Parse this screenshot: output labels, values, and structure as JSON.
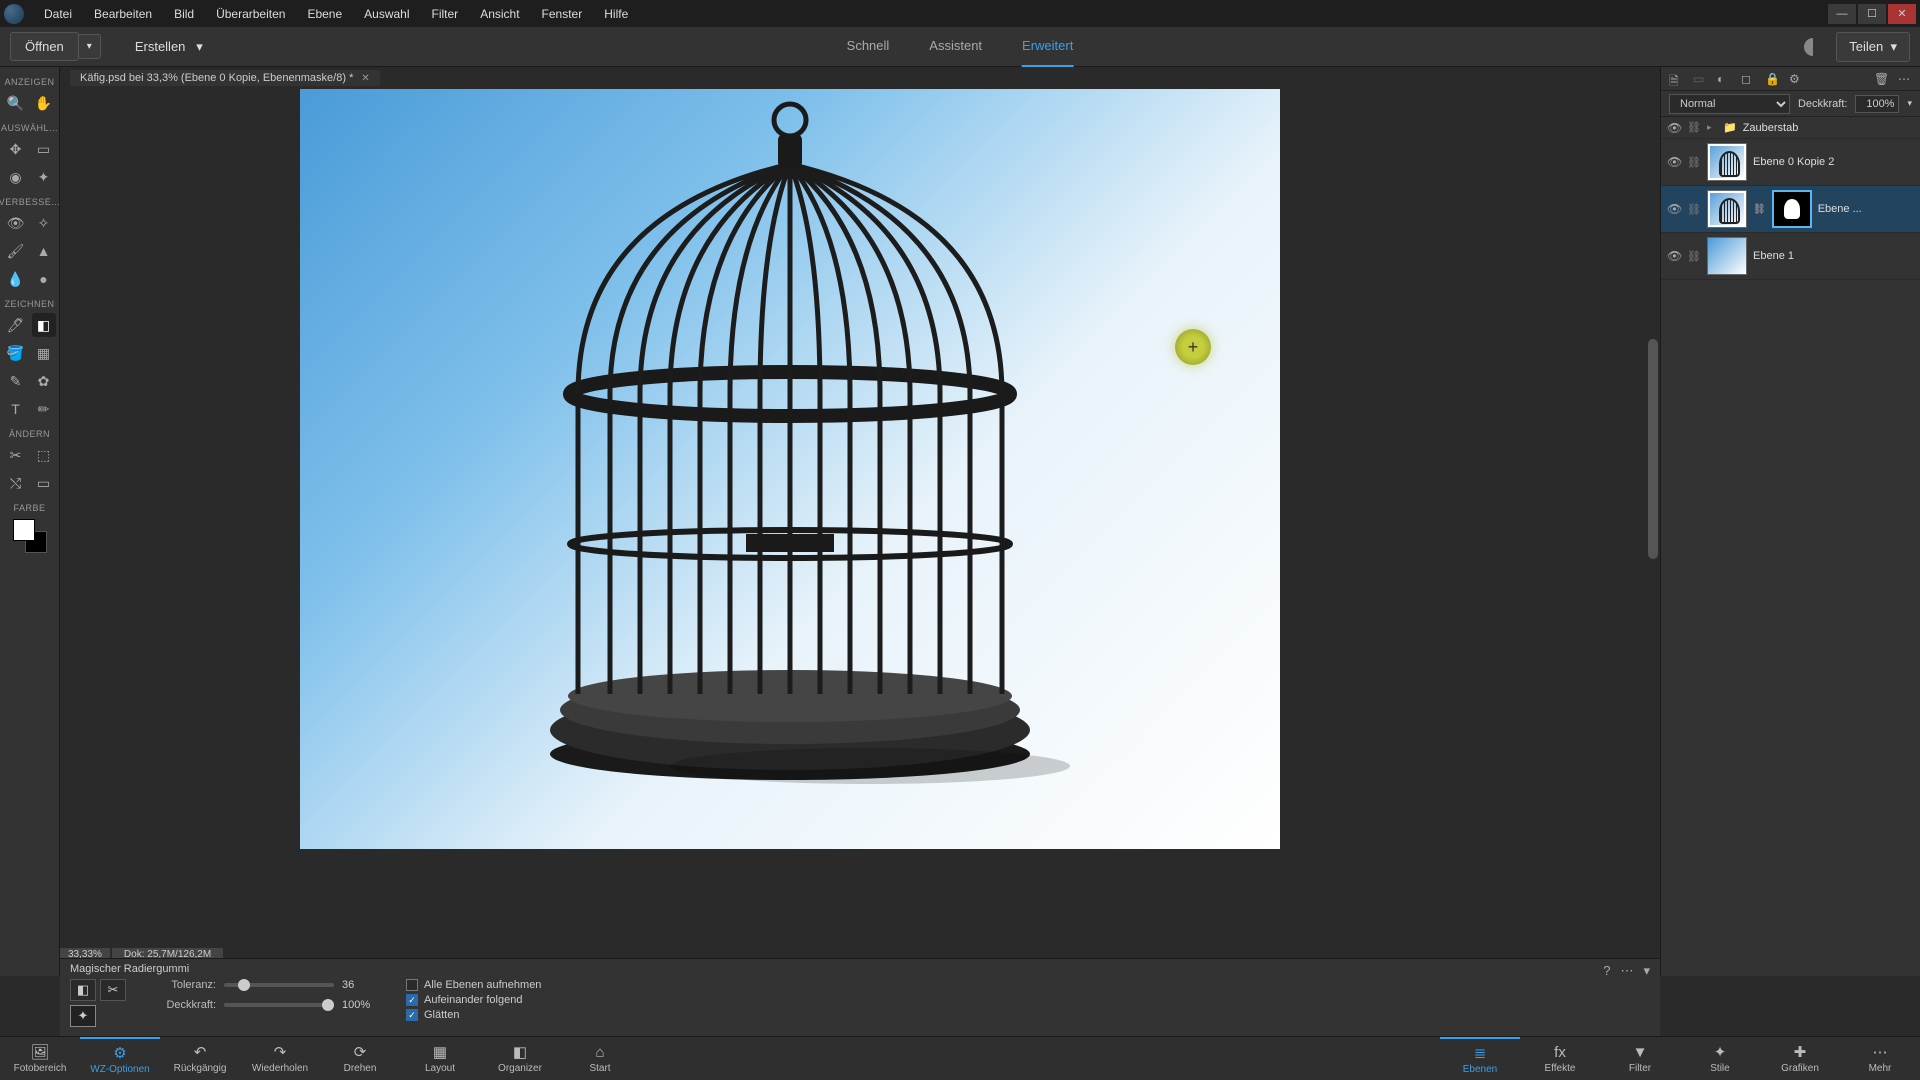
{
  "menu": [
    "Datei",
    "Bearbeiten",
    "Bild",
    "Überarbeiten",
    "Ebene",
    "Auswahl",
    "Filter",
    "Ansicht",
    "Fenster",
    "Hilfe"
  ],
  "secondbar": {
    "open": "Öffnen",
    "create": "Erstellen",
    "modes": {
      "quick": "Schnell",
      "guided": "Assistent",
      "expert": "Erweitert"
    },
    "share": "Teilen"
  },
  "toolbox": {
    "sections": {
      "view": "ANZEIGEN",
      "select": "AUSWÄHL...",
      "enhance": "VERBESSE...",
      "draw": "ZEICHNEN",
      "modify": "ÄNDERN",
      "color": "FARBE"
    }
  },
  "document": {
    "tab": "Käfig.psd bei 33,3% (Ebene 0 Kopie, Ebenenmaske/8) *",
    "zoom": "33,33%",
    "docinfo": "Dok: 25,7M/126,2M"
  },
  "layers_panel": {
    "blend": "Normal",
    "opacity_label": "Deckkraft:",
    "opacity_value": "100%",
    "group": "Zauberstab",
    "layer_a": "Ebene 0 Kopie 2",
    "layer_b": "Ebene ...",
    "layer_c": "Ebene 1"
  },
  "tool_options": {
    "title": "Magischer Radiergummi",
    "tolerance_label": "Toleranz:",
    "tolerance_value": "36",
    "opacity_label": "Deckkraft:",
    "opacity_value": "100%",
    "check_all_layers": "Alle Ebenen aufnehmen",
    "check_contiguous": "Aufeinander folgend",
    "check_antialias": "Glätten"
  },
  "taskbar": {
    "left": {
      "photobin": "Fotobereich",
      "tooloptions": "WZ-Optionen",
      "undo": "Rückgängig",
      "redo": "Wiederholen",
      "rotate": "Drehen",
      "layout": "Layout",
      "organizer": "Organizer",
      "home": "Start"
    },
    "right": {
      "layers": "Ebenen",
      "effects": "Effekte",
      "filter": "Filter",
      "styles": "Stile",
      "graphics": "Grafiken",
      "more": "Mehr"
    }
  }
}
